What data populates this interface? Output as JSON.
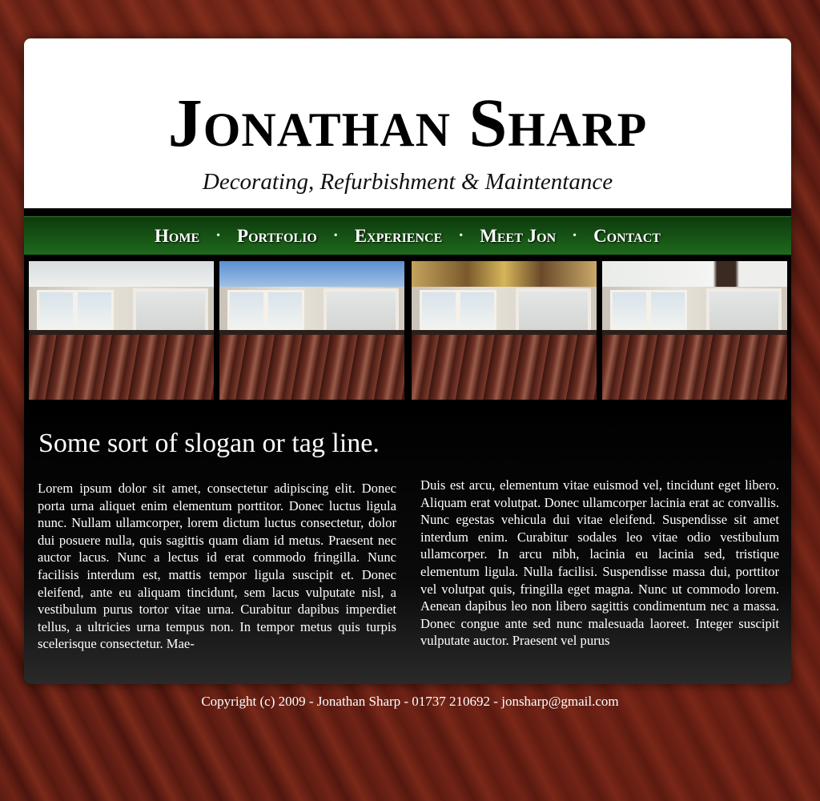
{
  "header": {
    "title": "Jonathan Sharp",
    "tagline": "Decorating, Refurbishment & Maintentance"
  },
  "nav": {
    "items": [
      {
        "label": "Home"
      },
      {
        "label": "Portfolio"
      },
      {
        "label": "Experience"
      },
      {
        "label": "Meet Jon"
      },
      {
        "label": "Contact"
      }
    ],
    "separator": "•"
  },
  "gallery": {
    "images": [
      {
        "subject": "room-with-hardwood-floor"
      },
      {
        "subject": "room-with-hardwood-floor"
      },
      {
        "subject": "room-with-hardwood-floor"
      },
      {
        "subject": "room-with-hardwood-floor"
      }
    ]
  },
  "main": {
    "slogan": "Some sort of slogan or tag line.",
    "column_left": "Lorem ipsum dolor sit amet, consectetur adipiscing elit. Donec porta urna aliquet enim elementum porttitor. Donec luctus ligula nunc. Nullam ullamcorper, lorem dictum luctus consectetur, dolor dui posuere nulla, quis sagittis quam diam id metus. Praesent nec auctor lacus. Nunc a lectus id erat commodo fringilla. Nunc facilisis interdum est, mattis tempor ligula suscipit et. Donec eleifend, ante eu aliquam tincidunt, sem lacus vulputate nisl, a vestibulum purus tortor vitae urna. Curabitur dapibus imperdiet tellus, a ultricies urna tempus non. In tempor metus quis turpis scelerisque consectetur. Mae-",
    "column_right": "Duis est arcu, elementum vitae euismod vel, tincidunt eget libero. Aliquam erat volutpat. Donec ullamcorper lacinia erat ac convallis. Nunc egestas vehicula dui vitae eleifend. Suspendisse sit amet interdum enim. Curabitur sodales leo vitae odio vestibulum ullamcorper. In arcu nibh, lacinia eu lacinia sed, tristique elementum ligula. Nulla facilisi. Suspendisse massa dui, porttitor vel volutpat quis, fringilla eget magna. Nunc ut commodo lorem. Aenean dapibus leo non libero sagittis condimentum nec a massa. Donec congue ante sed nunc malesuada laoreet. Integer suscipit vulputate auctor. Praesent vel purus"
  },
  "footer": {
    "text": "Copyright (c) 2009 - Jonathan Sharp - 01737 210692 - jonsharp@gmail.com"
  },
  "colors": {
    "nav_green": "#1f6a1d",
    "background_wood": "#5a1a12"
  }
}
